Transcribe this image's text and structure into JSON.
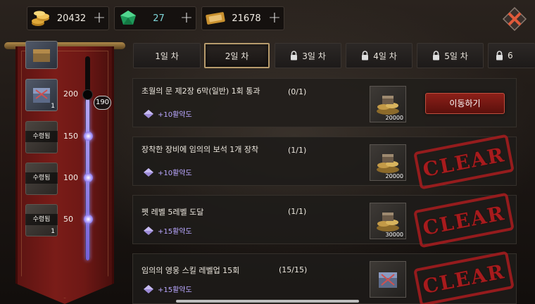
{
  "currencies": {
    "gold": {
      "icon": "gold-coins-icon",
      "value": "20432",
      "plus": "+"
    },
    "gem": {
      "icon": "green-gem-icon",
      "value": "27",
      "plus": "+"
    },
    "ticket": {
      "icon": "ticket-icon",
      "value": "21678",
      "plus": "+"
    }
  },
  "progress": {
    "current_points": "190",
    "milestones": [
      {
        "points": "200",
        "count": "1",
        "claimed": false
      },
      {
        "points": "150",
        "status": "수령됨",
        "claimed": true
      },
      {
        "points": "100",
        "status": "수령됨",
        "claimed": true
      },
      {
        "points": "50",
        "status": "수령됨",
        "count": "1",
        "claimed": true
      }
    ]
  },
  "tabs": [
    {
      "label": "1일 차",
      "locked": false
    },
    {
      "label": "2일 차",
      "locked": false,
      "active": true
    },
    {
      "label": "3일 차",
      "locked": true
    },
    {
      "label": "4일 차",
      "locked": true
    },
    {
      "label": "5일 차",
      "locked": true
    },
    {
      "label": "6",
      "locked": true
    }
  ],
  "quests": [
    {
      "title": "초월의 문 제2장 6막(일반) 1회 통과",
      "progress": "(0/1)",
      "bonus": "+10활약도",
      "reward_amount": "20000",
      "action": "이동하기"
    },
    {
      "title": "장착한 장비에 임의의 보석 1개 장착",
      "progress": "(1/1)",
      "bonus": "+10활약도",
      "reward_amount": "20000",
      "stamp": "CLEAR"
    },
    {
      "title": "펫 레벨 5레벨 도달",
      "progress": "(1/1)",
      "bonus": "+15활약도",
      "reward_amount": "30000",
      "stamp": "CLEAR"
    },
    {
      "title": "임의의 영웅 스킬 레벨업 15회",
      "progress": "(15/15)",
      "bonus": "+15활약도",
      "stamp": "CLEAR"
    }
  ],
  "colors": {
    "accent_gold": "#b79b6c",
    "banner_red": "#7a1c18",
    "bonus_purple": "#b9a7ff",
    "button_red": "#8d2019"
  }
}
